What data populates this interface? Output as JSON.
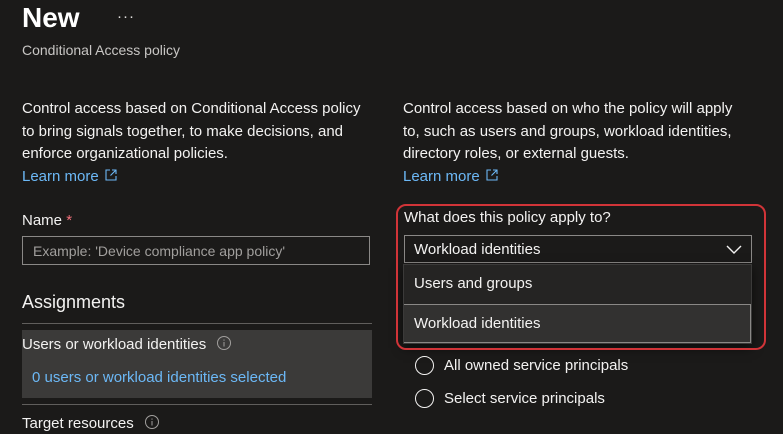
{
  "header": {
    "title": "New",
    "more_label": "···",
    "subtitle": "Conditional Access policy"
  },
  "left": {
    "description": "Control access based on Conditional Access policy to bring signals together, to make decisions, and enforce organizational policies.",
    "learn_more": "Learn more",
    "name_label": "Name",
    "required_marker": "*",
    "name_placeholder": "Example: 'Device compliance app policy'",
    "assignments_heading": "Assignments",
    "users_label": "Users or workload identities",
    "users_value": "0 users or workload identities selected",
    "target_label": "Target resources"
  },
  "right": {
    "description": "Control access based on who the policy will apply to, such as users and groups, workload identities, directory roles, or external guests.",
    "learn_more": "Learn more",
    "question_label": "What does this policy apply to?",
    "selected_value": "Workload identities",
    "options": [
      "Users and groups",
      "Workload identities"
    ],
    "radio_options": [
      "All owned service principals",
      "Select service principals"
    ]
  },
  "colors": {
    "background": "#1b1a19",
    "link": "#6cb8f6",
    "highlight_border": "#d13438",
    "required": "#f1707b"
  },
  "icons": [
    "more-icon",
    "external-link-icon",
    "info-icon",
    "chevron-down-icon"
  ]
}
